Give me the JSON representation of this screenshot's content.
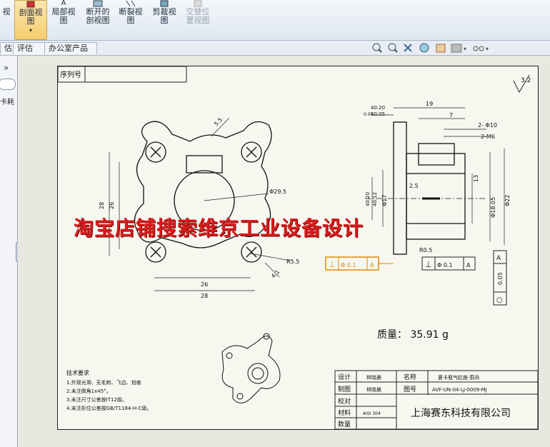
{
  "ribbon": {
    "items": [
      {
        "label_line1": "视",
        "label_line2": ""
      },
      {
        "label_line1": "剖面视",
        "label_line2": "图"
      },
      {
        "label_line1": "局部视",
        "label_line2": "图"
      },
      {
        "label_line1": "断开的",
        "label_line2": "剖视图"
      },
      {
        "label_line1": "断裂视",
        "label_line2": "图"
      },
      {
        "label_line1": "剪裁视",
        "label_line2": "图"
      },
      {
        "label_line1": "交替位",
        "label_line2": "置视图"
      }
    ],
    "section_letter": "A"
  },
  "tabs": [
    "估",
    "评估",
    "办公室产品"
  ],
  "left_panel": {
    "label": "卡耗",
    "toggle": "»"
  },
  "drawing": {
    "serial_label": "序列号",
    "roughness": "3.2",
    "watermark": "淘宝店铺搜索维京工业设备设计",
    "mass": "质量： 35.91 g",
    "dims_front": [
      "5.5",
      "28",
      "26",
      "Φ29.5",
      "26",
      "28",
      "R5.5",
      "4.1"
    ],
    "dims_side": [
      "19",
      "7",
      "2- Φ10",
      "2-M6",
      "40.20",
      "40.05",
      "0.05",
      "40.20",
      "40.12",
      "Φ17",
      "2.5",
      "13",
      "Φ18.05",
      "Φ22",
      "R0.5"
    ],
    "tolerances": [
      {
        "symbol": "⊥",
        "value": "Φ 0.1",
        "datum": "A"
      },
      {
        "symbol": "⊥",
        "value": "Φ 0.1",
        "datum": "A"
      },
      {
        "symbol": "○",
        "value": "0.05",
        "datum": "A"
      }
    ],
    "notes": {
      "title": "技术要求",
      "lines": [
        "1.外观光滑、无毛刺、飞边、划痕",
        "2.未注倒角1x45°。",
        "3.未注尺寸公差按IT12级。",
        "4.未注形位公差按GB/T1184-H-C级。"
      ]
    },
    "title_block": {
      "rows": [
        {
          "label": "设计",
          "value": "林晓晨"
        },
        {
          "label": "制图",
          "value": "林晓晨"
        },
        {
          "label": "校对",
          "value": ""
        },
        {
          "label": "材料",
          "value": "AISI 304"
        },
        {
          "label": "数量",
          "value": ""
        }
      ],
      "name_label": "名称",
      "name_value": "夏卡瓶气缸座-蔚兵",
      "drawing_no_label": "图号",
      "drawing_no_value": "AVF-UN-04-LJ-0009-MJ",
      "company": "上海赛东科技有限公司"
    }
  }
}
